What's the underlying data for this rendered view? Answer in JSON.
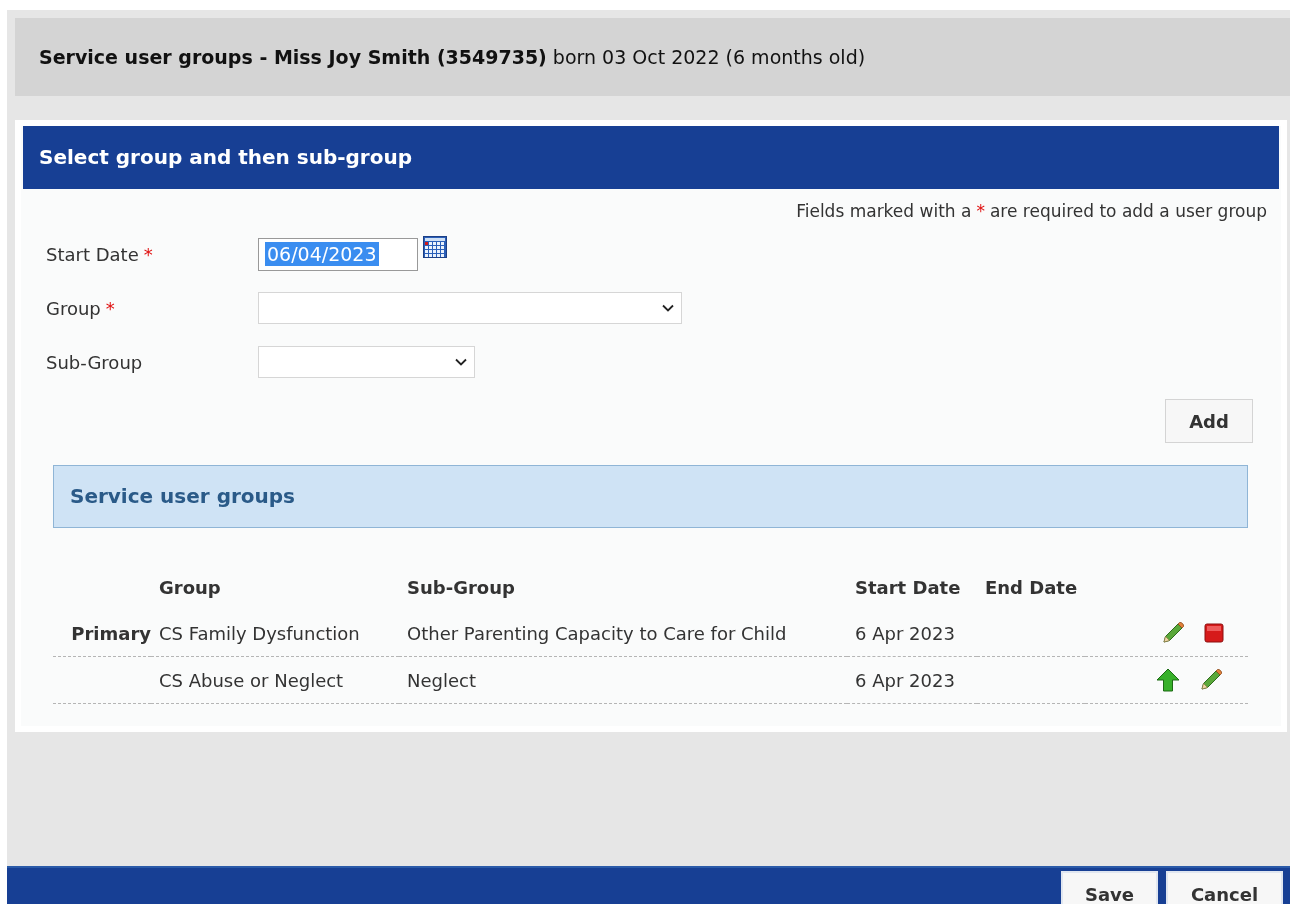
{
  "header": {
    "title": "**Service user groups - Miss Joy Smith (3549735)** born 03 Oct 2022 (6 months old)"
  },
  "form": {
    "title": "Select group and then sub-group",
    "note": {
      "before": "Fields marked with a",
      "mark": "*",
      "after": "are required to add a user group"
    },
    "fields": [
      {
        "kind": "date",
        "label": "Start Date",
        "required_mark": "*",
        "value": "06/04/2023",
        "highlighted": true
      },
      {
        "kind": "select",
        "label": "Group",
        "required_mark": "*"
      },
      {
        "kind": "select",
        "label": "Sub-Group"
      }
    ],
    "add_button": "Add"
  },
  "groups": {
    "title": "Service user groups",
    "columns": [
      "",
      "Group",
      "Sub-Group",
      "Start Date",
      "End Date"
    ],
    "rows": [
      {
        "primary_label": "Primary",
        "group": "CS Family Dysfunction",
        "sub_group": "Other Parenting Capacity to Care for Child",
        "start_date": "6 Apr 2023",
        "actions": [
          {
            "kind": "edit"
          },
          {
            "kind": "end"
          }
        ]
      },
      {
        "group": "CS Abuse or Neglect",
        "sub_group": "Neglect",
        "start_date": "6 Apr 2023",
        "actions": [
          {
            "kind": "make-primary"
          },
          {
            "kind": "edit"
          }
        ]
      }
    ]
  },
  "footer": {
    "buttons": [
      "Save",
      "Cancel"
    ]
  }
}
